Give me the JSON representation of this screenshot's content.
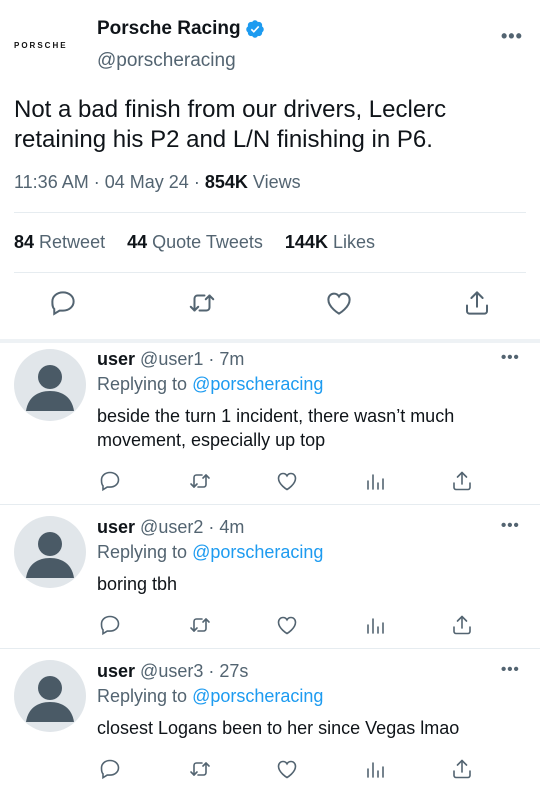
{
  "tweet": {
    "logo_text": "PORSCHE",
    "author_name": "Porsche Racing",
    "handle": "@porscheracing",
    "text": "Not a bad finish from our drivers, Leclerc retaining his P2 and L/N finishing in P6.",
    "time": "11:36 AM",
    "date": "04 May 24",
    "views_count": "854K",
    "views_label": "Views",
    "retweets": "84",
    "retweets_label": "Retweet",
    "quotes": "44",
    "quotes_label": "Quote Tweets",
    "likes": "144K",
    "likes_label": "Likes",
    "accent": "#1d9bf0",
    "icons": [
      "reply-icon",
      "retweet-icon",
      "like-icon",
      "share-icon"
    ]
  },
  "replies": [
    {
      "name": "user",
      "handle": "@user1",
      "time": "7m",
      "replying_label": "Replying to",
      "replying_to": "@porscheracing",
      "text": "beside the turn 1 incident, there wasn’t much movement, especially up top"
    },
    {
      "name": "user",
      "handle": "@user2",
      "time": "4m",
      "replying_label": "Replying to",
      "replying_to": "@porscheracing",
      "text": "boring tbh"
    },
    {
      "name": "user",
      "handle": "@user3",
      "time": "27s",
      "replying_label": "Replying to",
      "replying_to": "@porscheracing",
      "text": "closest Logans been to her since Vegas lmao"
    }
  ],
  "more_label": "•••",
  "dot_sep": "·"
}
